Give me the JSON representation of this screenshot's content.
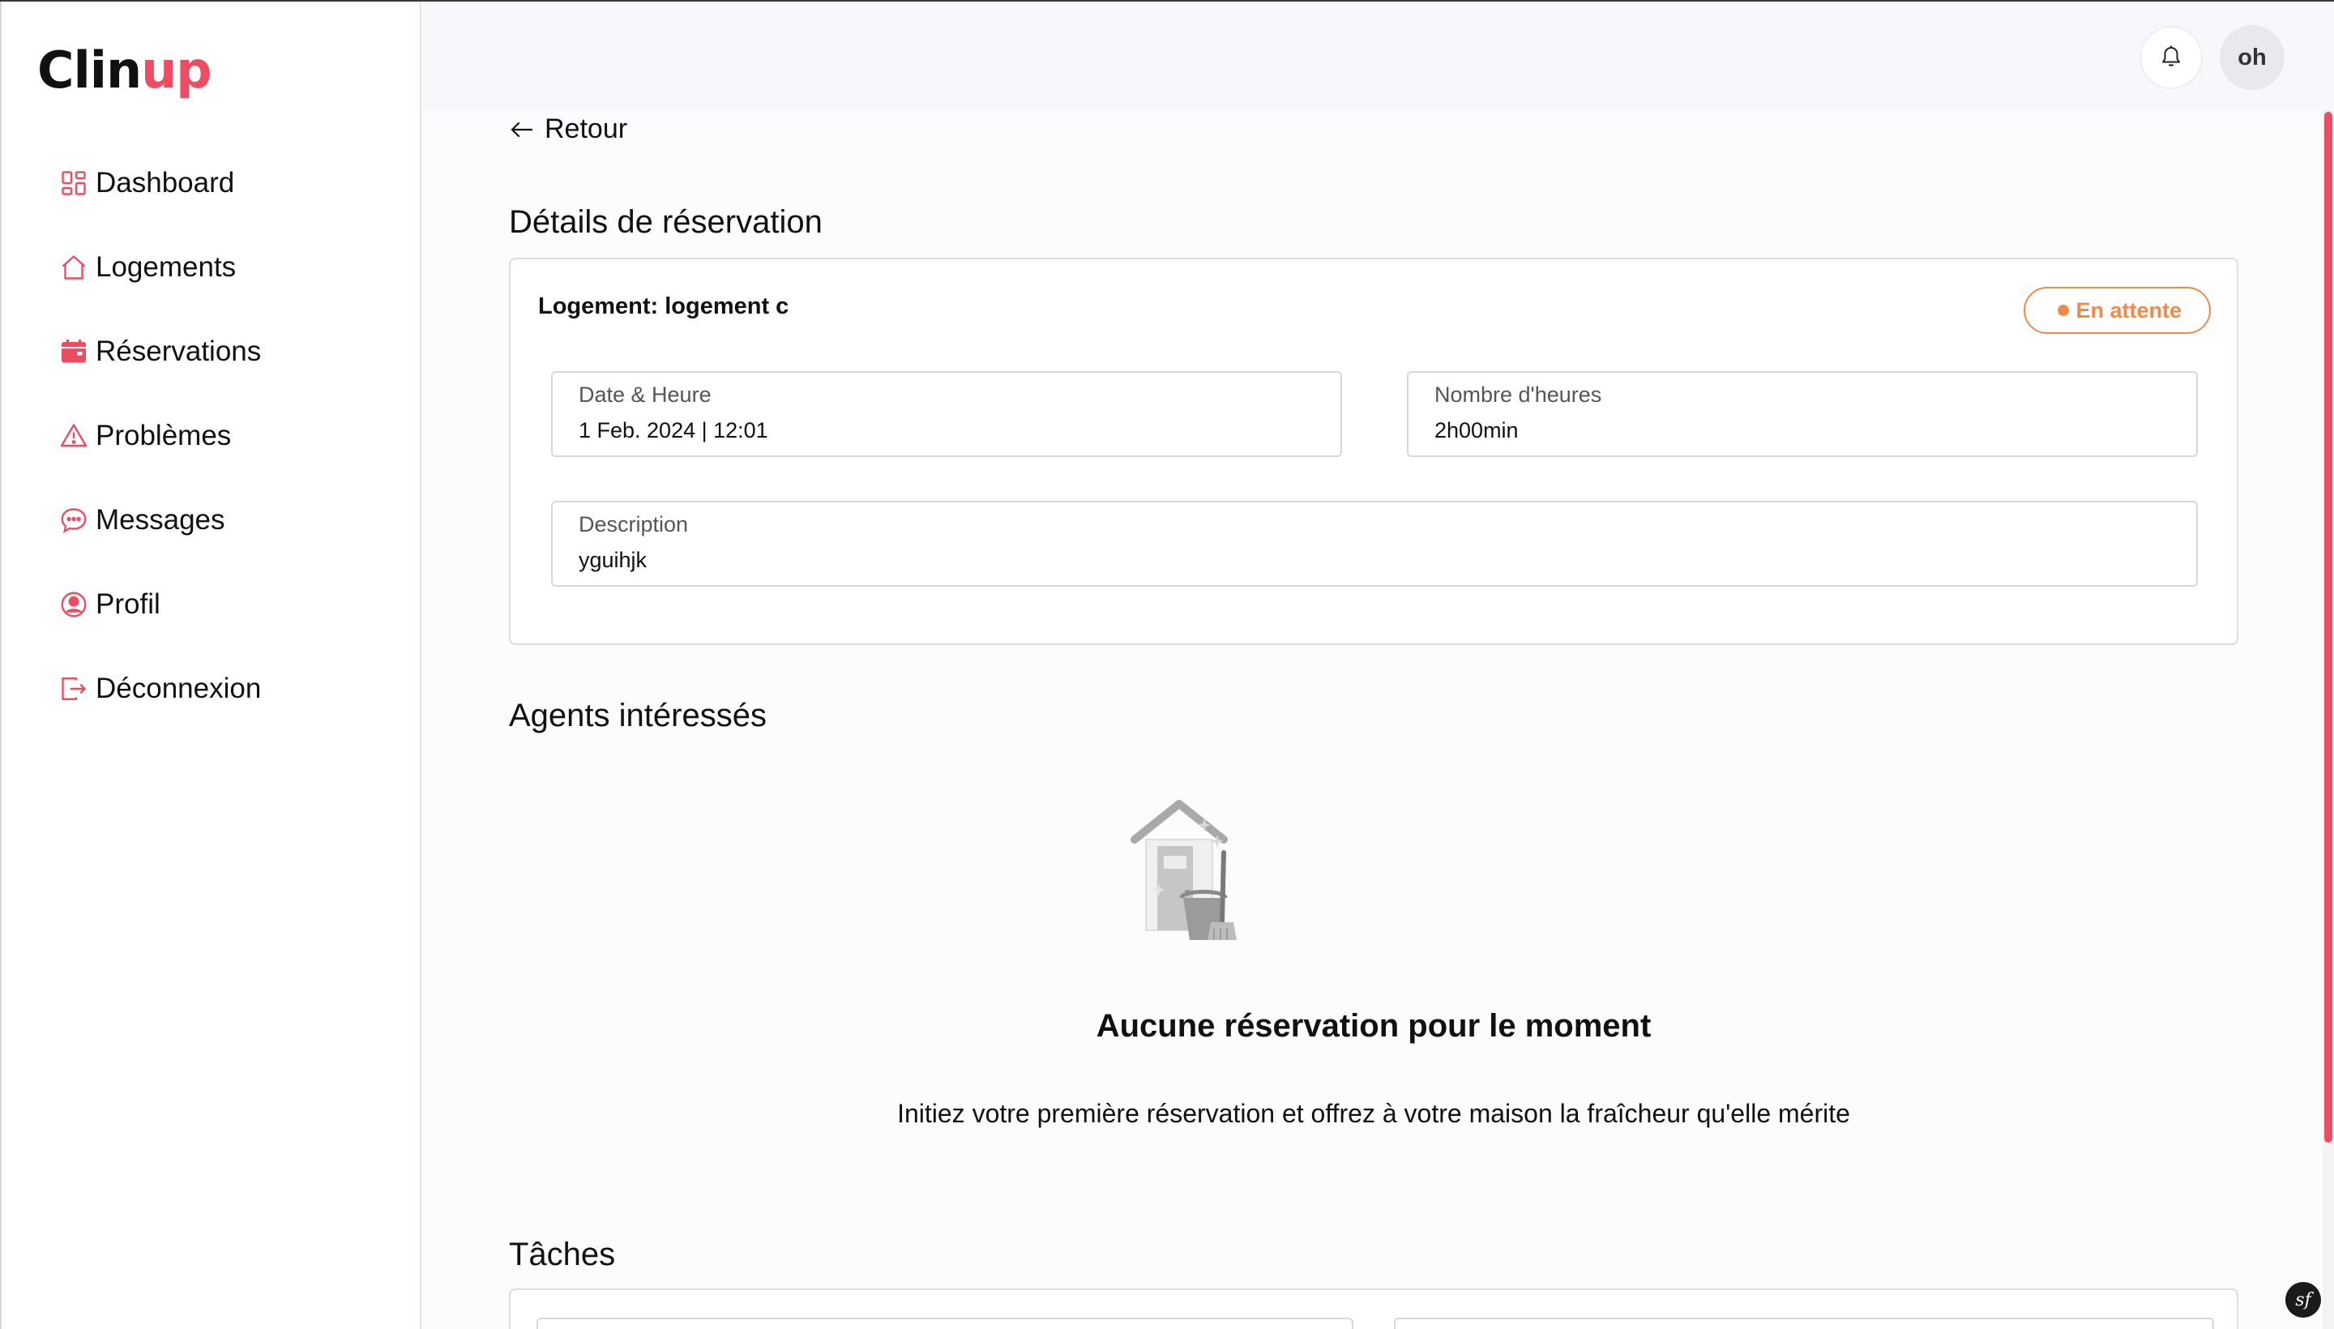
{
  "app": {
    "logo_part1": "Clin",
    "logo_part2": "up",
    "accent_color": "#ec4d62"
  },
  "sidebar": {
    "items": [
      {
        "label": "Dashboard",
        "icon": "dashboard-grid-icon"
      },
      {
        "label": "Logements",
        "icon": "home-icon"
      },
      {
        "label": "Réservations",
        "icon": "calendar-icon"
      },
      {
        "label": "Problèmes",
        "icon": "warning-icon"
      },
      {
        "label": "Messages",
        "icon": "chat-bubble-icon"
      },
      {
        "label": "Profil",
        "icon": "user-circle-icon"
      },
      {
        "label": "Déconnexion",
        "icon": "logout-icon"
      }
    ]
  },
  "header": {
    "avatar_initials": "oh",
    "bell_icon": "bell-icon"
  },
  "page": {
    "back_label": "Retour",
    "details_title": "Détails de réservation",
    "logement_label": "Logement:",
    "logement_value": "logement c",
    "status_label": "En attente",
    "status_color": "#f08a4b",
    "fields": {
      "date_label": "Date & Heure",
      "date_value": "1 Feb. 2024 | 12:01",
      "hours_label": "Nombre d'heures",
      "hours_value": "2h00min",
      "description_label": "Description",
      "description_value": "yguihjk"
    },
    "agents_title": "Agents intéressés",
    "empty_title": "Aucune réservation pour le moment",
    "empty_subtitle": "Initiez votre première réservation et offrez à votre maison la fraîcheur qu'elle mérite",
    "tasks_title": "Tâches"
  },
  "footer": {
    "symfony_badge": "sf"
  }
}
